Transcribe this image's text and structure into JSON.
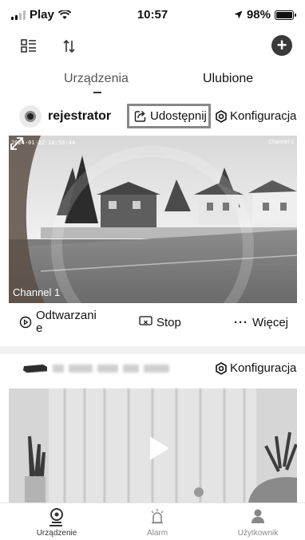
{
  "status_bar": {
    "carrier": "Play",
    "time": "10:57",
    "battery": "98%",
    "battery_level": 0.98
  },
  "toolbar": {
    "icons": [
      "grid-list-icon",
      "sort-icon",
      "add-icon"
    ]
  },
  "tabs": [
    {
      "label": "Urządzenia",
      "active": true
    },
    {
      "label": "Ulubione",
      "active": false
    }
  ],
  "device": {
    "name": "rejestrator",
    "share_label": "Udostępnij",
    "config_label": "Konfiguracja",
    "feed": {
      "timestamp": "2024-01-22 10:50:44",
      "channel_corner": "Channel 1",
      "channel_label": "Channel 1"
    }
  },
  "controls": {
    "playback_label": "Odtwarzanie",
    "playback_line1": "Odtwarzani",
    "playback_line2": "e",
    "stop_label": "Stop",
    "more_label": "Więcej"
  },
  "device2": {
    "config_label": "Konfiguracja"
  },
  "bottom_nav": [
    {
      "label": "Urządzenie",
      "icon": "camera-icon",
      "active": true
    },
    {
      "label": "Alarm",
      "icon": "alarm-icon",
      "active": false
    },
    {
      "label": "Użytkownik",
      "icon": "user-icon",
      "active": false
    }
  ],
  "colors": {
    "accent": "#333333",
    "share_border": "#888888",
    "inactive_nav": "#888888"
  }
}
